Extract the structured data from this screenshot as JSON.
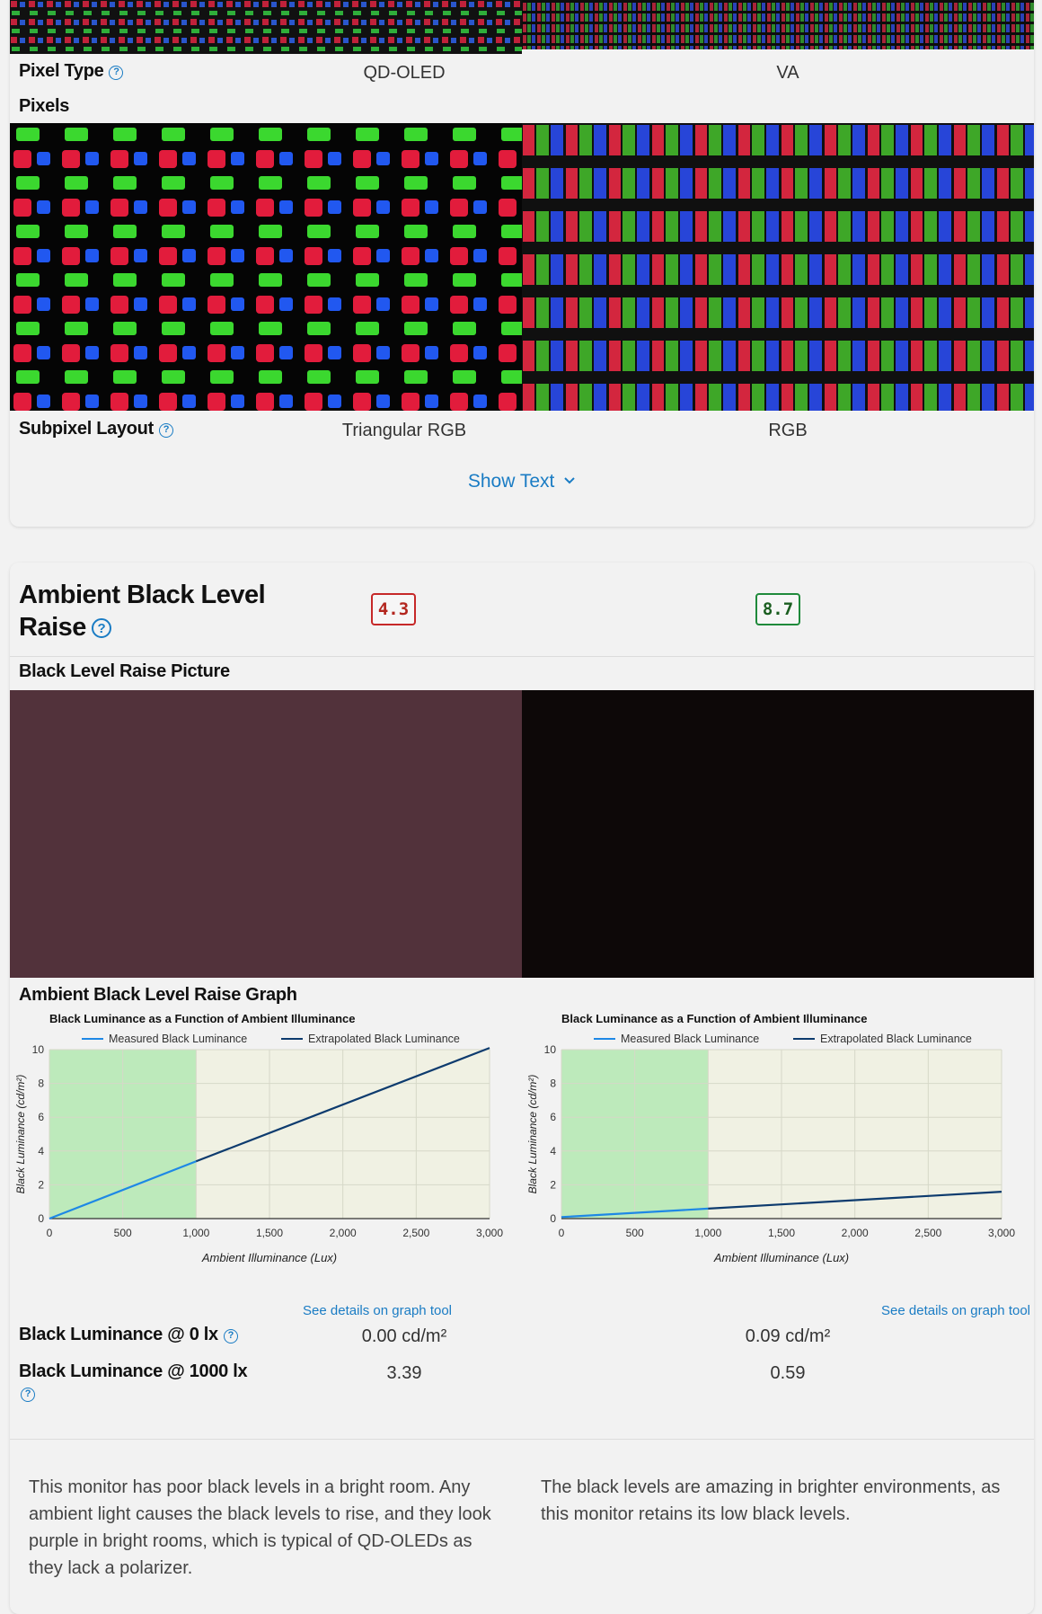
{
  "rows": {
    "pixel_type": {
      "label": "Pixel Type",
      "left": "QD-OLED",
      "right": "VA"
    },
    "pixels": {
      "label": "Pixels"
    },
    "subpixel_layout": {
      "label": "Subpixel Layout",
      "left": "Triangular RGB",
      "right": "RGB"
    }
  },
  "show_text": "Show Text",
  "section": {
    "title": "Ambient Black Level Raise",
    "score_left": "4.3",
    "score_right": "8.7",
    "picture_label": "Black Level Raise Picture",
    "graph_label": "Ambient Black Level Raise Graph",
    "details_link": "See details on graph tool",
    "lum0": {
      "label": "Black Luminance @ 0 lx",
      "left": "0.00 cd/m²",
      "right": "0.09 cd/m²"
    },
    "lum1000": {
      "label": "Black Luminance @ 1000 lx",
      "left": "3.39",
      "right": "0.59"
    },
    "text_left": "This monitor has poor black levels in a bright room. Any ambient light causes the black levels to rise, and they look purple in bright rooms, which is typical of QD-OLEDs as they lack a polarizer.",
    "text_right": "The black levels are amazing in brighter environments, as this monitor retains its low black levels."
  },
  "colors": {
    "accent": "#1a7cc4",
    "score_bad": "#c62828",
    "score_good": "#1f8a3b",
    "left_black_sample": "#52323b",
    "right_black_sample": "#0d0808"
  },
  "chart_data": [
    {
      "type": "line",
      "title": "Black Luminance as a Function of Ambient Illuminance",
      "xlabel": "Ambient Illuminance (Lux)",
      "ylabel": "Black Luminance (cd/m²)",
      "xlim": [
        0,
        3000
      ],
      "ylim": [
        0,
        10
      ],
      "xticks": [
        "0",
        "500",
        "1,000",
        "1,500",
        "2,000",
        "2,500",
        "3,000"
      ],
      "yticks": [
        "0",
        "2",
        "4",
        "6",
        "8",
        "10"
      ],
      "grid": true,
      "legend": "top",
      "series": [
        {
          "name": "Measured Black Luminance",
          "color": "#1e88e5",
          "x": [
            0,
            1000
          ],
          "y": [
            0.0,
            3.39
          ]
        },
        {
          "name": "Extrapolated Black Luminance",
          "color": "#0d3b6e",
          "x": [
            1000,
            3000
          ],
          "y": [
            3.39,
            10.1
          ]
        }
      ]
    },
    {
      "type": "line",
      "title": "Black Luminance as a Function of Ambient Illuminance",
      "xlabel": "Ambient Illuminance (Lux)",
      "ylabel": "Black Luminance (cd/m²)",
      "xlim": [
        0,
        3000
      ],
      "ylim": [
        0,
        10
      ],
      "xticks": [
        "0",
        "500",
        "1,000",
        "1,500",
        "2,000",
        "2,500",
        "3,000"
      ],
      "yticks": [
        "0",
        "2",
        "4",
        "6",
        "8",
        "10"
      ],
      "grid": true,
      "legend": "top",
      "series": [
        {
          "name": "Measured Black Luminance",
          "color": "#1e88e5",
          "x": [
            0,
            1000
          ],
          "y": [
            0.09,
            0.59
          ]
        },
        {
          "name": "Extrapolated Black Luminance",
          "color": "#0d3b6e",
          "x": [
            1000,
            3000
          ],
          "y": [
            0.59,
            1.59
          ]
        }
      ]
    }
  ]
}
